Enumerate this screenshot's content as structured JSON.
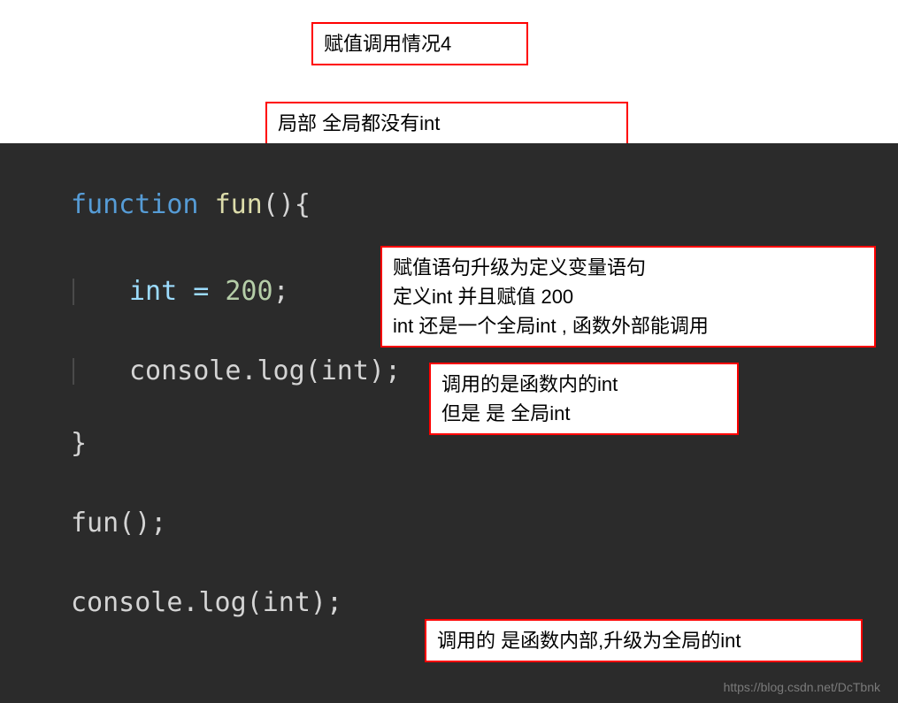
{
  "annotations": {
    "a1": "赋值调用情况4",
    "a2": "局部   全局都没有int",
    "a3_l1": "赋值语句升级为定义变量语句",
    "a3_l2": "定义int 并且赋值 200",
    "a3_l3": "int 还是一个全局int , 函数外部能调用",
    "a4_l1": "调用的是函数内的int",
    "a4_l2": "但是 是 全局int",
    "a5": "调用的 是函数内部,升级为全局的int"
  },
  "code": {
    "kw_function": "function",
    "fn_name": "fun",
    "paren_open": "(){",
    "assign_line": "int = ",
    "assign_num": "200",
    "semicolon": ";",
    "console_log": "console.log(int);",
    "brace_close": "}",
    "fn_call": "fun();",
    "outer_log": "console.log(int);"
  },
  "watermark": "https://blog.csdn.net/DcTbnk"
}
